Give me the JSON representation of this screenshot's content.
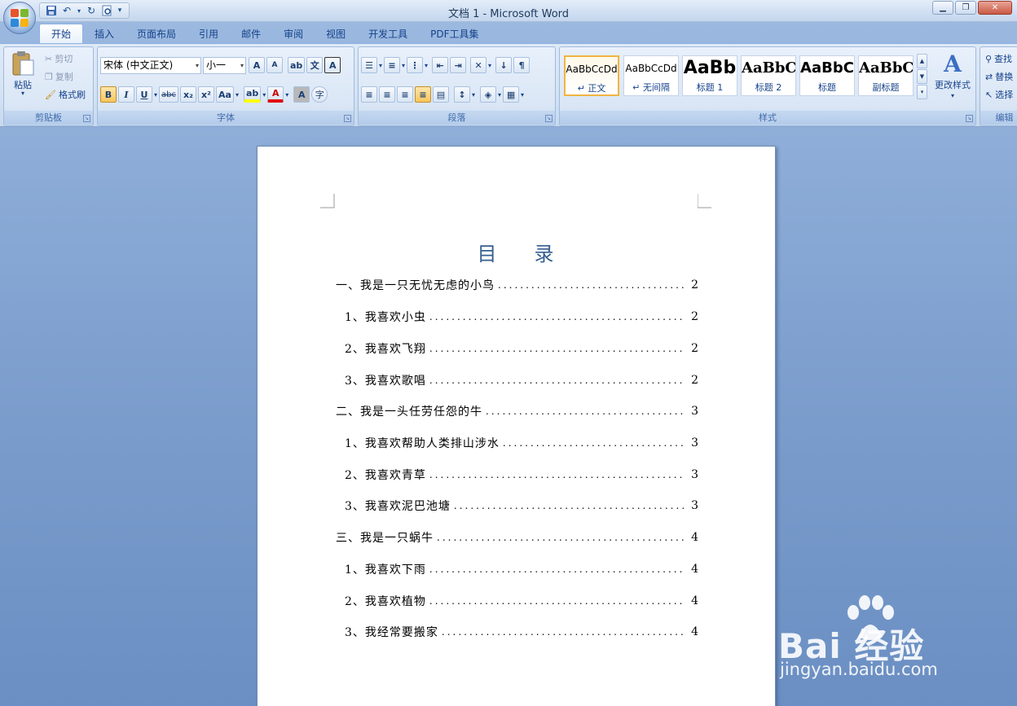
{
  "window": {
    "title": "文档 1 - Microsoft Word"
  },
  "tabs": [
    "开始",
    "插入",
    "页面布局",
    "引用",
    "邮件",
    "审阅",
    "视图",
    "开发工具",
    "PDF工具集"
  ],
  "clipboard": {
    "paste": "粘贴",
    "cut": "剪切",
    "copy": "复制",
    "format_painter": "格式刷",
    "label": "剪贴板"
  },
  "font": {
    "family": "宋体 (中文正文)",
    "size": "小一",
    "label": "字体",
    "grow": "A",
    "shrink": "A",
    "phonetic": "文",
    "border_char": "A",
    "bold": "B",
    "italic": "I",
    "underline": "U",
    "strike": "abc",
    "sub": "x₂",
    "sup": "x²",
    "case": "Aa",
    "color_a": "A",
    "shade_a": "A",
    "enclose": "字"
  },
  "paragraph": {
    "label": "段落"
  },
  "styles": {
    "label": "样式",
    "items": [
      {
        "preview": "AaBbCcDd",
        "name": "↵ 正文"
      },
      {
        "preview": "AaBbCcDd",
        "name": "↵ 无间隔"
      },
      {
        "preview": "AaBb",
        "name": "标题 1"
      },
      {
        "preview": "AaBbC",
        "name": "标题 2"
      },
      {
        "preview": "AaBbC",
        "name": "标题"
      },
      {
        "preview": "AaBbC",
        "name": "副标题"
      }
    ],
    "change": "更改样式"
  },
  "editing": {
    "find": "查找",
    "replace": "替换",
    "select": "选择",
    "label": "编辑"
  },
  "document": {
    "title_chars": [
      "目",
      "录"
    ],
    "toc": [
      {
        "text": "一、我是一只无忧无虑的小鸟",
        "page": "2",
        "level": 1
      },
      {
        "text": "1、我喜欢小虫",
        "page": "2",
        "level": 2
      },
      {
        "text": "2、我喜欢飞翔",
        "page": "2",
        "level": 2
      },
      {
        "text": "3、我喜欢歌唱",
        "page": "2",
        "level": 2
      },
      {
        "text": "二、我是一头任劳任怨的牛",
        "page": "3",
        "level": 1
      },
      {
        "text": "1、我喜欢帮助人类排山涉水",
        "page": "3",
        "level": 2
      },
      {
        "text": "2、我喜欢青草",
        "page": "3",
        "level": 2
      },
      {
        "text": "3、我喜欢泥巴池塘",
        "page": "3",
        "level": 2
      },
      {
        "text": "三、我是一只蜗牛",
        "page": "4",
        "level": 1
      },
      {
        "text": "1、我喜欢下雨",
        "page": "4",
        "level": 2
      },
      {
        "text": "2、我喜欢植物",
        "page": "4",
        "level": 2
      },
      {
        "text": "3、我经常要搬家",
        "page": "4",
        "level": 2
      }
    ]
  },
  "watermark": {
    "brand": "Bai 经验",
    "url": "jingyan.baidu.com"
  }
}
